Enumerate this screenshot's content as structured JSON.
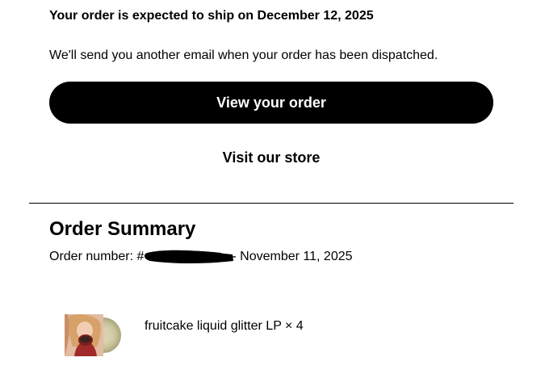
{
  "shipping": {
    "headline": "Your order is expected to ship on December 12, 2025",
    "note": "We'll send you another email when your order has been dispatched."
  },
  "actions": {
    "view_order_label": "View your order",
    "visit_store_label": "Visit our store"
  },
  "summary": {
    "title": "Order Summary",
    "order_number_prefix": "Order number: #",
    "order_date_suffix": "- November 11, 2025"
  },
  "items": [
    {
      "name": "fruitcake liquid glitter LP × 4",
      "thumbnail_icon": "album-cover-icon"
    }
  ],
  "colors": {
    "button_background": "#000000",
    "button_text": "#ffffff",
    "text": "#000000",
    "redaction": "#000000"
  }
}
